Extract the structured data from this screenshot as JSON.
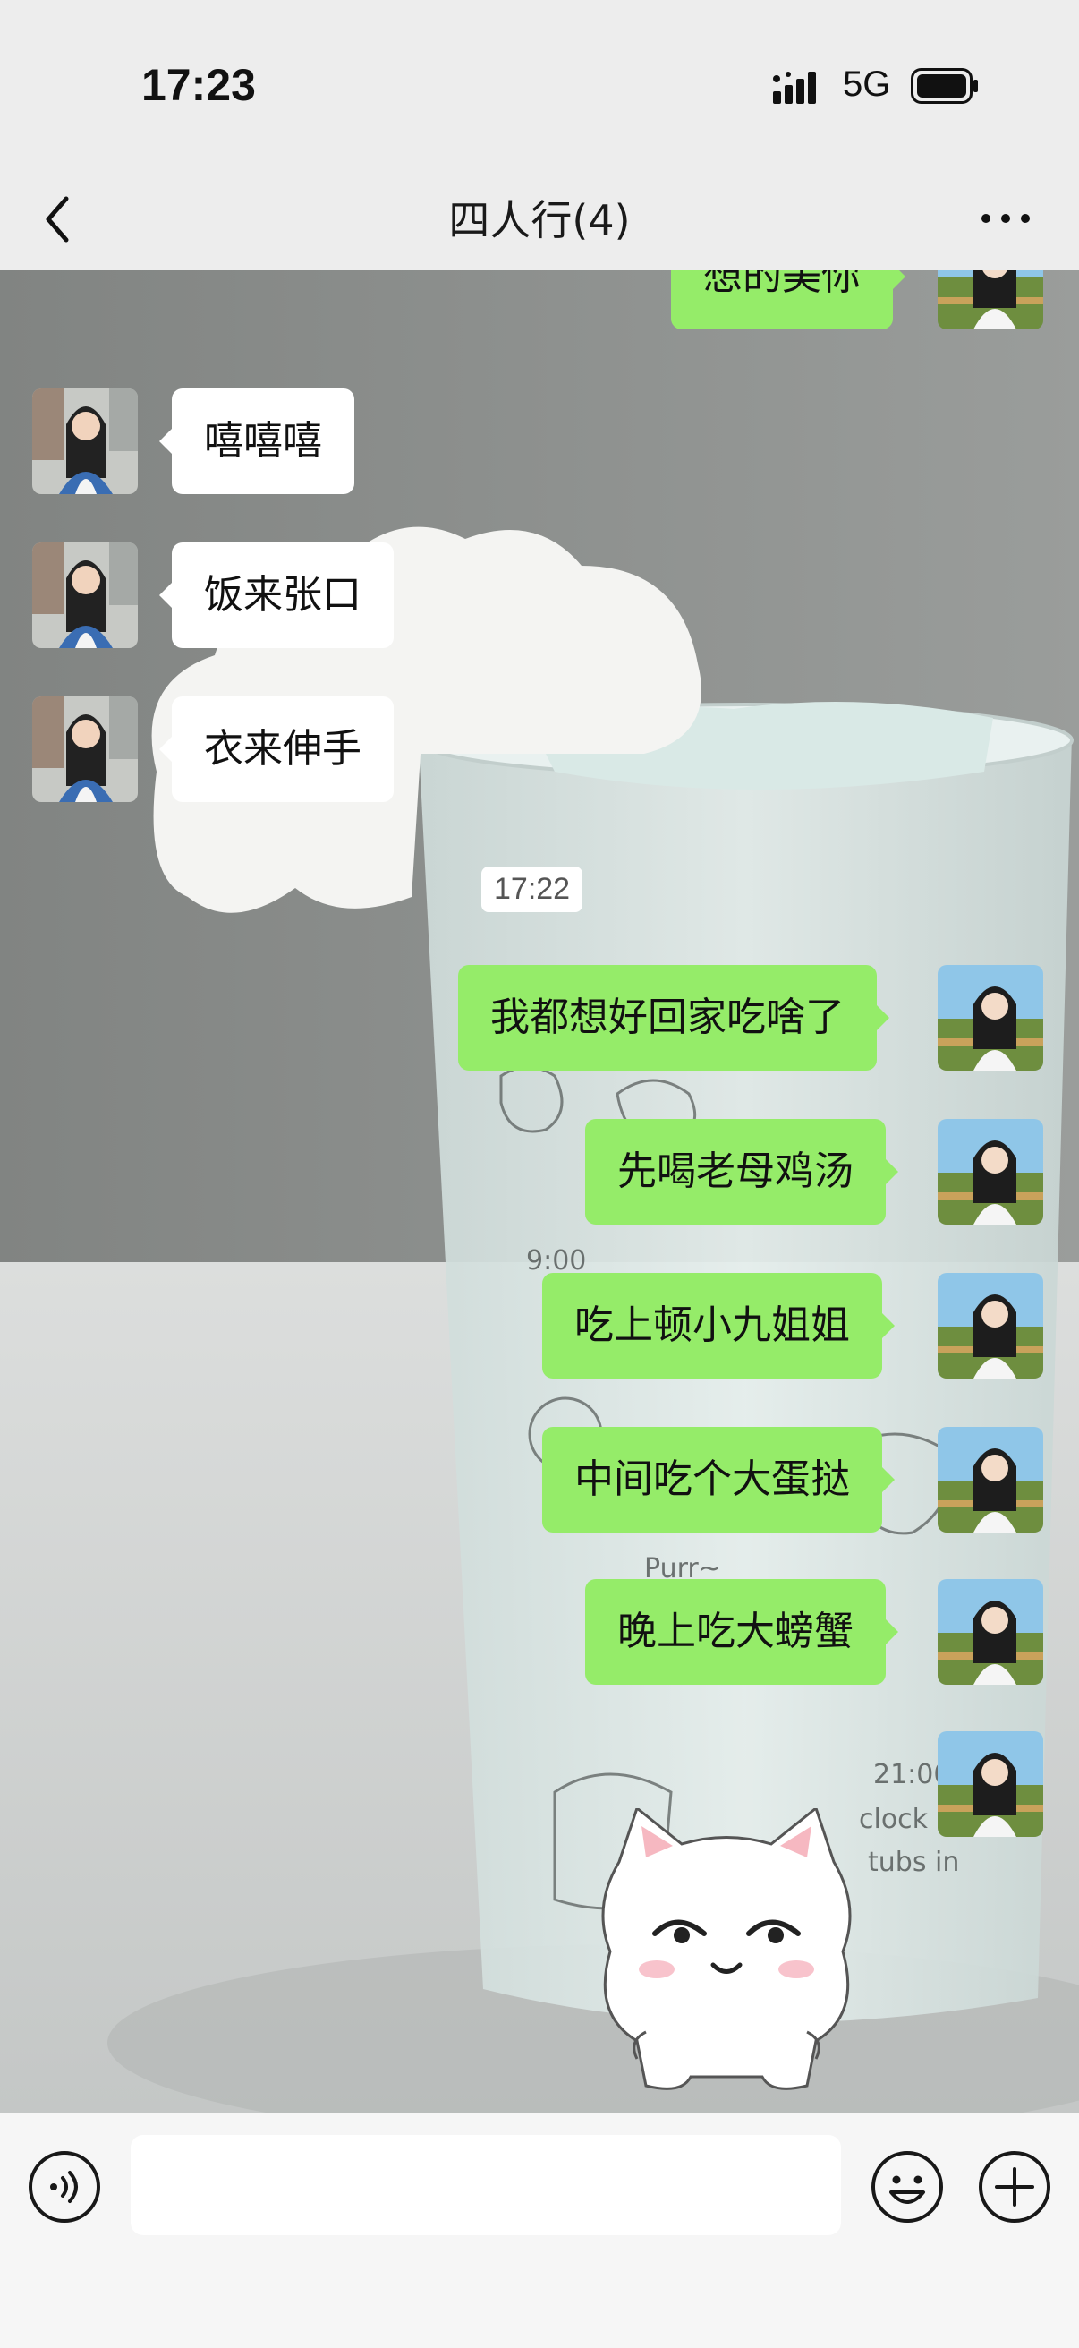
{
  "status_bar": {
    "time": "17:23",
    "network": "5G",
    "icons": [
      "signal-icon",
      "battery-icon"
    ]
  },
  "nav": {
    "title": "四人行(4)",
    "icons": [
      "back-icon",
      "more-icon"
    ]
  },
  "chat": {
    "messages": [
      {
        "side": "out",
        "text": "想的美你"
      },
      {
        "side": "in",
        "text": "嘻嘻嘻"
      },
      {
        "side": "in",
        "text": "饭来张口"
      },
      {
        "side": "in",
        "text": "衣来伸手"
      },
      {
        "side": "out",
        "text": "我都想好回家吃啥了"
      },
      {
        "side": "out",
        "text": "先喝老母鸡汤"
      },
      {
        "side": "out",
        "text": "吃上顿小九姐姐"
      },
      {
        "side": "out",
        "text": "中间吃个大蛋挞"
      },
      {
        "side": "out",
        "text": "晚上吃大螃蟹"
      },
      {
        "side": "out",
        "sticker": "white-cat-sticker"
      }
    ],
    "timestamp": "17:22",
    "wallpaper_text": [
      "9:00",
      "Purr~",
      "21:00",
      "clock",
      "tubs in"
    ]
  },
  "input_bar": {
    "icons": [
      "voice-icon",
      "emoji-icon",
      "plus-icon"
    ]
  },
  "colors": {
    "out_bubble": "#95ec69",
    "in_bubble": "#ffffff",
    "bar_bg": "#ededed"
  }
}
